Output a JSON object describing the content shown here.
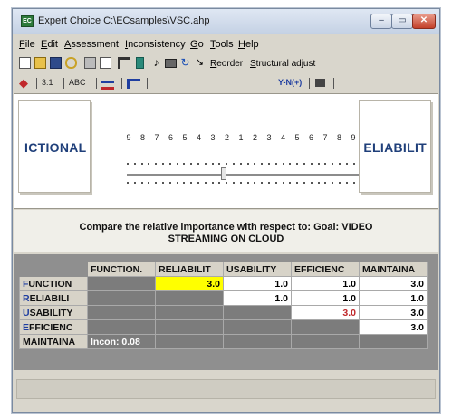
{
  "window": {
    "title": "Expert Choice    C:\\ECsamples\\VSC.ahp",
    "controls": [
      "–",
      "▭",
      "✕"
    ]
  },
  "menu": [
    "File",
    "Edit",
    "Assessment",
    "Inconsistency",
    "Go",
    "Tools",
    "Help"
  ],
  "toolbar": {
    "icons": [
      "new-file-icon",
      "open-folder-icon",
      "save-icon",
      "link-icon",
      "print-icon",
      "preview-icon",
      "tree-icon",
      "bookmark-icon",
      "music-note-icon",
      "grid-icon",
      "refresh-icon",
      "wand-icon"
    ],
    "reorder_label": "Reorder",
    "structural_adjust_label": "Structural adjust"
  },
  "view_tabs": {
    "numeric": "3:1",
    "verbal": "ABC",
    "y_label": "Y-N(+)"
  },
  "compare": {
    "left_label": "ICTIONAL",
    "right_label": "ELIABILIT",
    "scale": [
      "9",
      "8",
      "7",
      "6",
      "5",
      "4",
      "3",
      "2",
      "1",
      "2",
      "3",
      "4",
      "5",
      "6",
      "7",
      "8",
      "9"
    ],
    "slider_value": 3
  },
  "question": {
    "line1": "Compare the relative importance  with respect to: Goal: VIDEO",
    "line2": "STREAMING ON CLOUD"
  },
  "matrix": {
    "columns": [
      "FUNCTION.",
      "RELIABILIT",
      "USABILITY",
      "EFFICIENC",
      "MAINTAINA"
    ],
    "rows": [
      {
        "first": "F",
        "rest": "UNCTION",
        "cells": [
          "",
          "3.0",
          "1.0",
          "1.0",
          "3.0"
        ]
      },
      {
        "first": "R",
        "rest": "ELIABILI",
        "cells": [
          "",
          "",
          "1.0",
          "1.0",
          "1.0"
        ]
      },
      {
        "first": "U",
        "rest": "SABILITY",
        "cells": [
          "",
          "",
          "",
          "3.0",
          "3.0"
        ]
      },
      {
        "first": "E",
        "rest": "FFICIENC",
        "cells": [
          "",
          "",
          "",
          "",
          "3.0"
        ]
      },
      {
        "first": "",
        "rest": "MAINTAINA",
        "cells": [
          "",
          "",
          "",
          "",
          ""
        ]
      }
    ],
    "inconsistency": "Incon: 0.08",
    "highlight_color": "#ffff00",
    "inverse_color": "#c0282b"
  }
}
